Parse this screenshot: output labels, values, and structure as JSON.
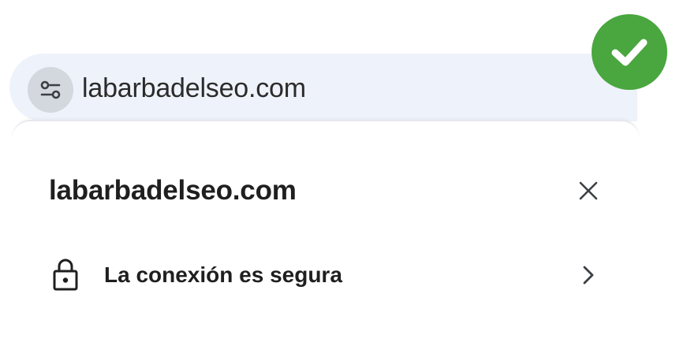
{
  "omnibox": {
    "url": "labarbadelseo.com",
    "site_settings_icon": "tune-icon"
  },
  "popup": {
    "title": "labarbadelseo.com",
    "close_icon": "close-icon",
    "connection": {
      "label": "La conexión es segura",
      "icon": "lock-icon",
      "chevron": "chevron-right-icon"
    }
  },
  "badge": {
    "icon": "check-icon",
    "color": "#4aa63f"
  },
  "colors": {
    "omnibox_bg": "#eef2fa",
    "icon_chip_bg": "#d3d7de",
    "text": "#1f1f1f"
  }
}
